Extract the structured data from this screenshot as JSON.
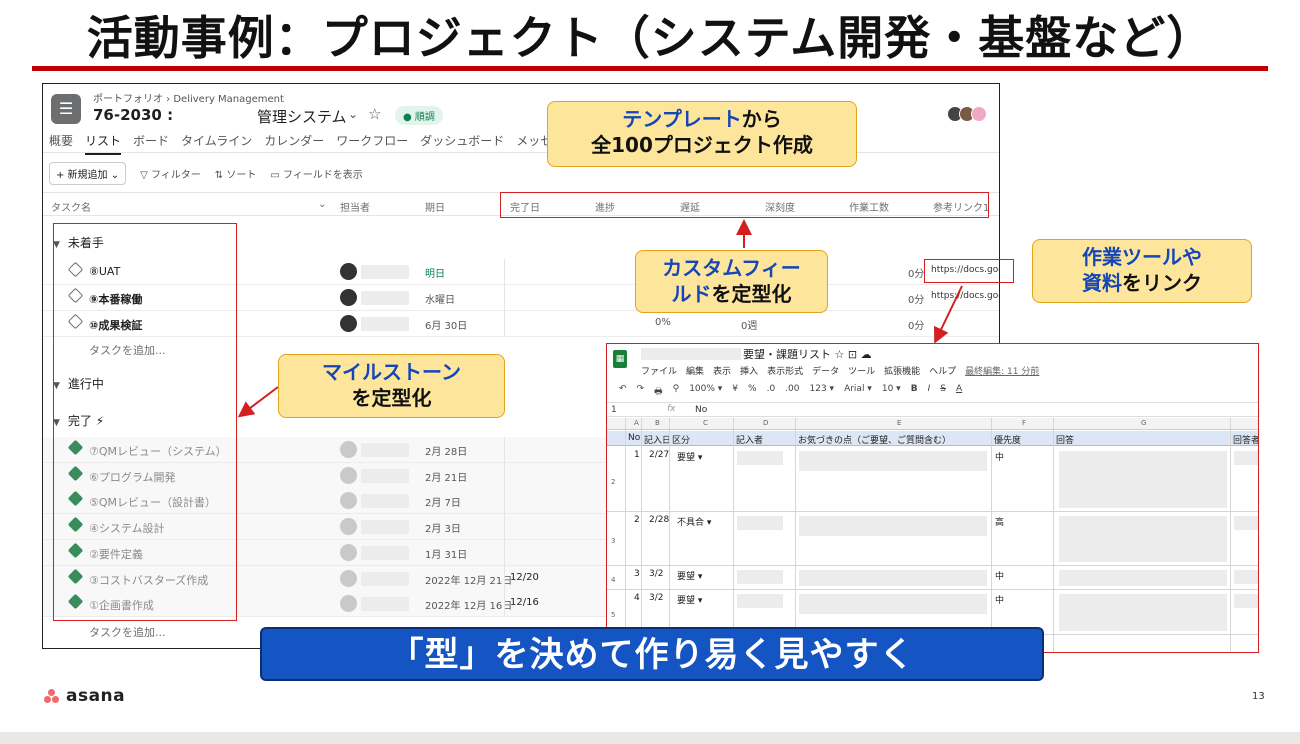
{
  "slide": {
    "title": "活動事例：プロジェクト（システム開発・基盤など）",
    "banner": "「型」を決めて作り易く見やすく",
    "logo_text": "asana",
    "page_number": "13",
    "accent_color": "#c00000"
  },
  "callouts": {
    "template_line1_blue": "テンプレート",
    "template_line1_rest": "から",
    "template_line2": "全100プロジェクト作成",
    "custom_line1_blue": "カスタムフィー",
    "custom_line2_blue": "ルド",
    "custom_line2_rest": "を定型化",
    "tools_line1_blue": "作業ツールや",
    "tools_line2_blue": "資料",
    "tools_line2_rest": "をリンク",
    "milestone_line1_blue": "マイルストーン",
    "milestone_line2": "を定型化"
  },
  "asana": {
    "breadcrumb": "ポートフォリオ › Delivery Management",
    "project_id": "76-2030 :",
    "project_name": "管理システム",
    "status": "● 順調",
    "tabs": [
      "概要",
      "リスト",
      "ボード",
      "タイムライン",
      "カレンダー",
      "ワークフロー",
      "ダッシュボード",
      "メッセージ"
    ],
    "toolbar": {
      "add": "+ 新規追加 ⌄",
      "filter": "▽ フィルター",
      "sort": "⇅ ソート",
      "fields": "▭ フィールドを表示"
    },
    "columns": {
      "task": "タスク名",
      "assignee": "担当者",
      "due": "期日",
      "completed": "完了日",
      "progress": "進捗",
      "delay": "遅延",
      "depth": "深刻度",
      "effort": "作業工数",
      "link": "参考リンク1"
    },
    "sections": {
      "not_started": "未着手",
      "in_progress": "進行中",
      "done": "完了 ⚡"
    },
    "add_task": "タスクを追加...",
    "not_started_tasks": [
      {
        "name": "⑧UAT",
        "due": "明日",
        "effort": "0分",
        "link": "https://docs.goog"
      },
      {
        "name": "⑨本番稼働",
        "due": "水曜日",
        "effort": "0分",
        "link": "https://docs.goog"
      },
      {
        "name": "⑩成果検証",
        "due": "6月 30日",
        "progress": "0%",
        "delay": "0週",
        "effort": "0分"
      }
    ],
    "done_tasks": [
      {
        "name": "⑦QMレビュー（システム）",
        "due": "2月 28日",
        "completed": ""
      },
      {
        "name": "⑥プログラム開発",
        "due": "2月 21日",
        "completed": ""
      },
      {
        "name": "⑤QMレビュー（設計書）",
        "due": "2月 7日",
        "completed": ""
      },
      {
        "name": "④システム設計",
        "due": "2月 3日",
        "completed": ""
      },
      {
        "name": "②要件定義",
        "due": "1月 31日",
        "completed": ""
      },
      {
        "name": "③コストバスターズ作成",
        "due": "2022年 12月 21日",
        "completed": "12/20"
      },
      {
        "name": "①企画書作成",
        "due": "2022年 12月 16日",
        "completed": "12/16"
      }
    ]
  },
  "sheets": {
    "title": "要望・課題リスト ☆ ⊡ ☁",
    "menu": [
      "ファイル",
      "編集",
      "表示",
      "挿入",
      "表示形式",
      "データ",
      "ツール",
      "拡張機能",
      "ヘルプ"
    ],
    "last_edit": "最終編集: 11 分前",
    "toolbar": [
      "↶",
      "↷",
      "🖶",
      "⚲",
      "100% ▾",
      "¥",
      "%",
      ".0",
      ".00",
      "123 ▾",
      "Arial ▾",
      "10 ▾",
      "B",
      "I",
      "S",
      "A"
    ],
    "cell_ref": "1",
    "fx_label": "fx",
    "fx_value": "No",
    "column_letters": [
      "A",
      "B",
      "C",
      "D",
      "E",
      "F",
      "G"
    ],
    "headers": [
      "No",
      "記入日",
      "区分",
      "記入者",
      "お気づきの点（ご要望、ご質問含む）",
      "優先度",
      "回答",
      "回答者"
    ],
    "rows": [
      {
        "row": "2",
        "no": "1",
        "date": "2/27",
        "kind": "要望 ▾",
        "priority": "中"
      },
      {
        "row": "3",
        "no": "2",
        "date": "2/28",
        "kind": "不具合 ▾",
        "priority": "高"
      },
      {
        "row": "4",
        "no": "3",
        "date": "3/2",
        "kind": "要望 ▾",
        "priority": "中"
      },
      {
        "row": "5",
        "no": "4",
        "date": "3/2",
        "kind": "要望 ▾",
        "priority": "中"
      }
    ]
  }
}
